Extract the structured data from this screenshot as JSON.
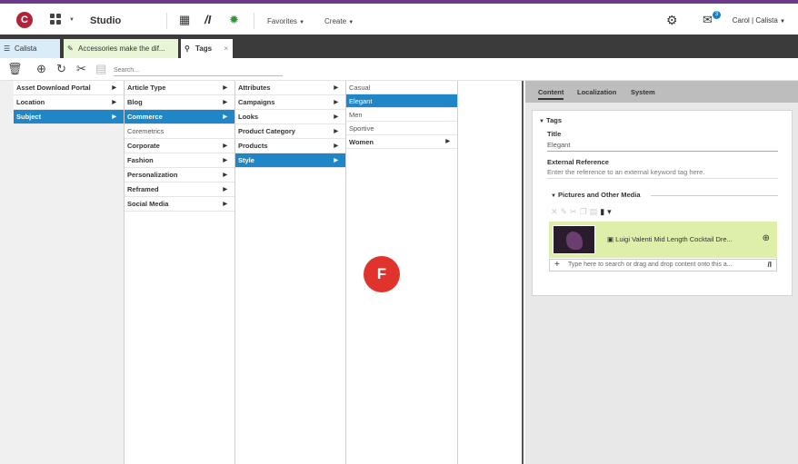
{
  "topbar": {
    "logo_letter": "C",
    "studio_label": "Studio",
    "favorites_label": "Favorites",
    "create_label": "Create",
    "notification_count": "3",
    "user_label": "Carol | Calista"
  },
  "tabs": [
    {
      "label": "Calista"
    },
    {
      "label": "Accessories make the dif..."
    },
    {
      "label": "Tags"
    }
  ],
  "toolbar": {
    "search_placeholder": "Search..."
  },
  "columns": {
    "col1": [
      "Asset Download Portal",
      "Location",
      "Subject"
    ],
    "col2": [
      "Article Type",
      "Blog",
      "Commerce",
      "Coremetrics",
      "Corporate",
      "Fashion",
      "Personalization",
      "Reframed",
      "Social Media"
    ],
    "col3": [
      "Attributes",
      "Campaigns",
      "Looks",
      "Product Category",
      "Products",
      "Style"
    ],
    "col4": [
      "Casual",
      "Elegant",
      "Men",
      "Sportive",
      "Women"
    ]
  },
  "fab_letter": "F",
  "panel": {
    "tabs": [
      "Content",
      "Localization",
      "System"
    ],
    "section_title": "Tags",
    "title_label": "Title",
    "title_value": "Elegant",
    "extref_label": "External Reference",
    "extref_placeholder": "Enter the reference to an external keyword tag here.",
    "media_section": "Pictures and Other Media",
    "media_item": "Luigi Valenti Mid Length Cocktail Dre...",
    "add_placeholder": "Type here to search or drag and drop content onto this a..."
  }
}
